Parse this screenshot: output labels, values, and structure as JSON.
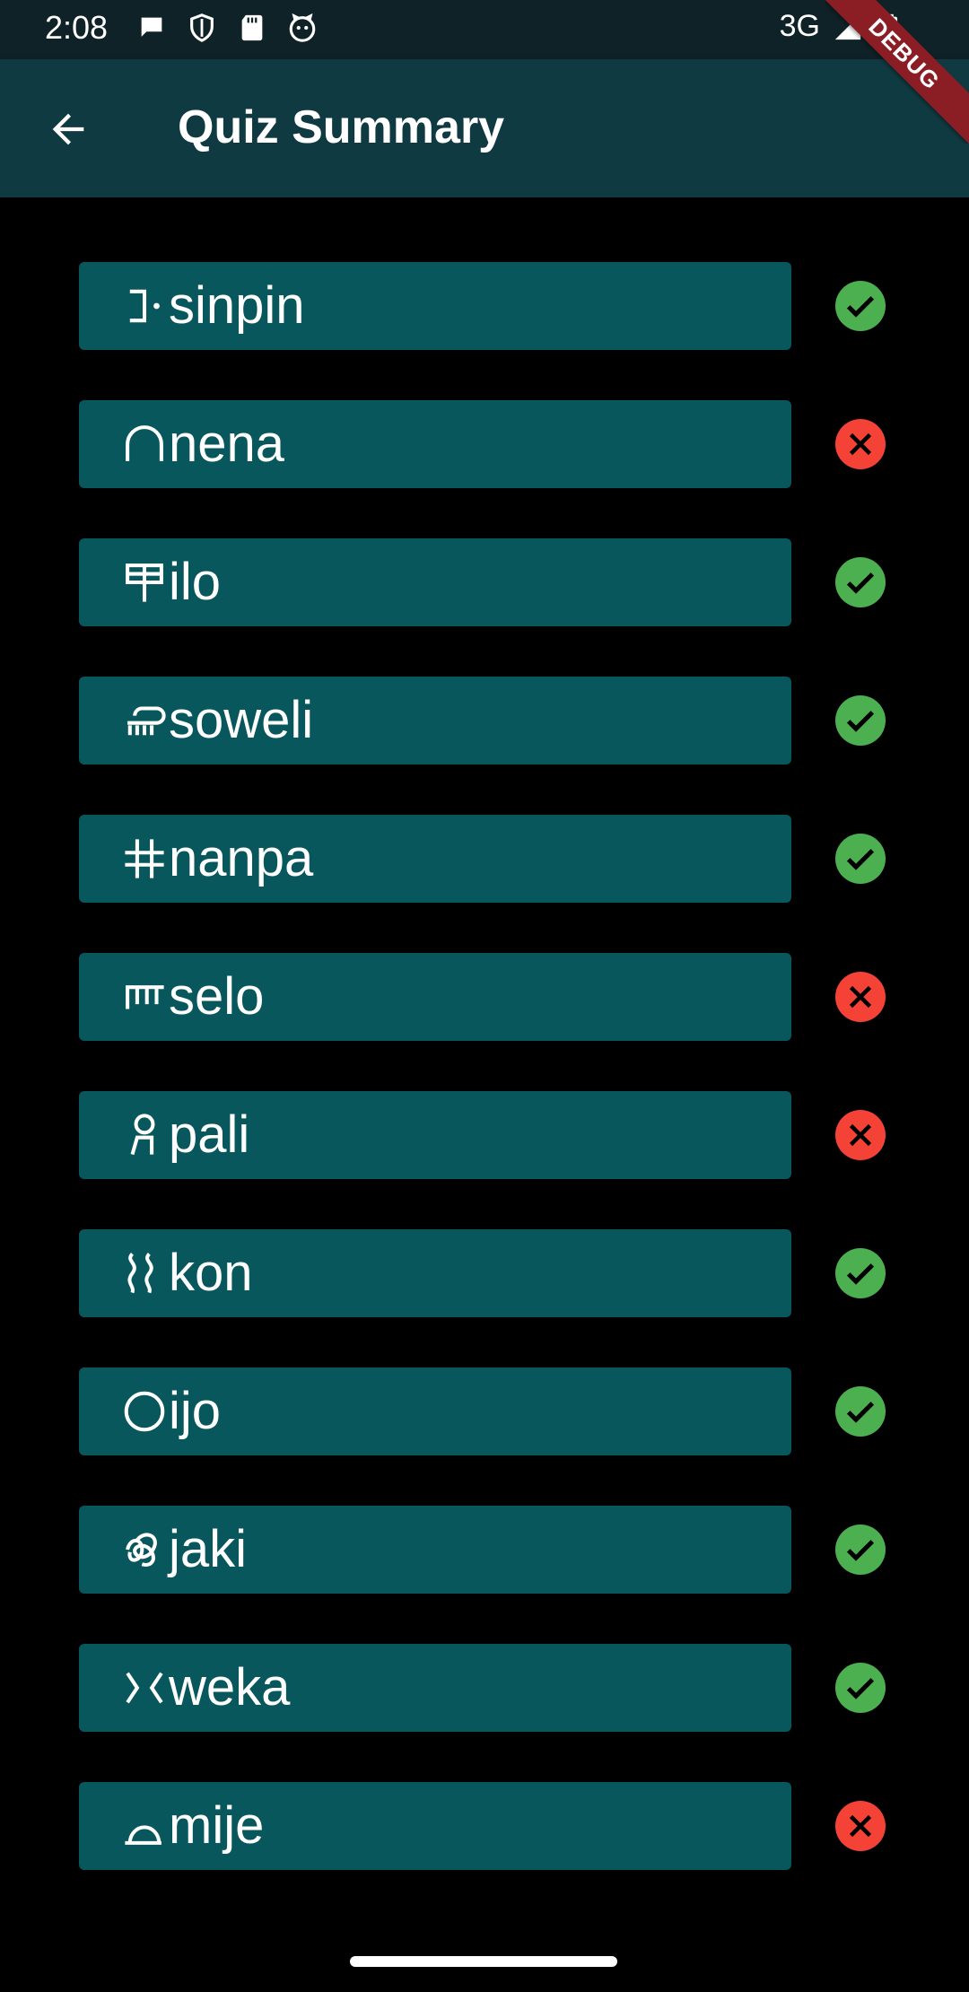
{
  "status_bar": {
    "time": "2:08",
    "network": "3G",
    "left_icons": [
      "message-icon",
      "shield-icon",
      "sd-card-icon",
      "cat-icon"
    ],
    "right_icons": [
      "signal-icon",
      "battery-icon"
    ]
  },
  "app_bar": {
    "title": "Quiz Summary",
    "back_icon": "arrow-back-icon",
    "debug_label": "DEBUG"
  },
  "colors": {
    "card": "#07575c",
    "correct": "#4caf50",
    "wrong": "#f44336",
    "app_bar": "#0f3a42"
  },
  "quiz_items": [
    {
      "word": "sinpin",
      "glyph": "sinpin-glyph-icon",
      "result": "correct"
    },
    {
      "word": "nena",
      "glyph": "nena-glyph-icon",
      "result": "wrong"
    },
    {
      "word": "ilo",
      "glyph": "ilo-glyph-icon",
      "result": "correct"
    },
    {
      "word": "soweli",
      "glyph": "soweli-glyph-icon",
      "result": "correct"
    },
    {
      "word": "nanpa",
      "glyph": "nanpa-glyph-icon",
      "result": "correct"
    },
    {
      "word": "selo",
      "glyph": "selo-glyph-icon",
      "result": "wrong"
    },
    {
      "word": "pali",
      "glyph": "pali-glyph-icon",
      "result": "wrong"
    },
    {
      "word": "kon",
      "glyph": "kon-glyph-icon",
      "result": "correct"
    },
    {
      "word": "ijo",
      "glyph": "ijo-glyph-icon",
      "result": "correct"
    },
    {
      "word": "jaki",
      "glyph": "jaki-glyph-icon",
      "result": "correct"
    },
    {
      "word": "weka",
      "glyph": "weka-glyph-icon",
      "result": "correct"
    },
    {
      "word": "mije",
      "glyph": "mije-glyph-icon",
      "result": "wrong"
    }
  ]
}
